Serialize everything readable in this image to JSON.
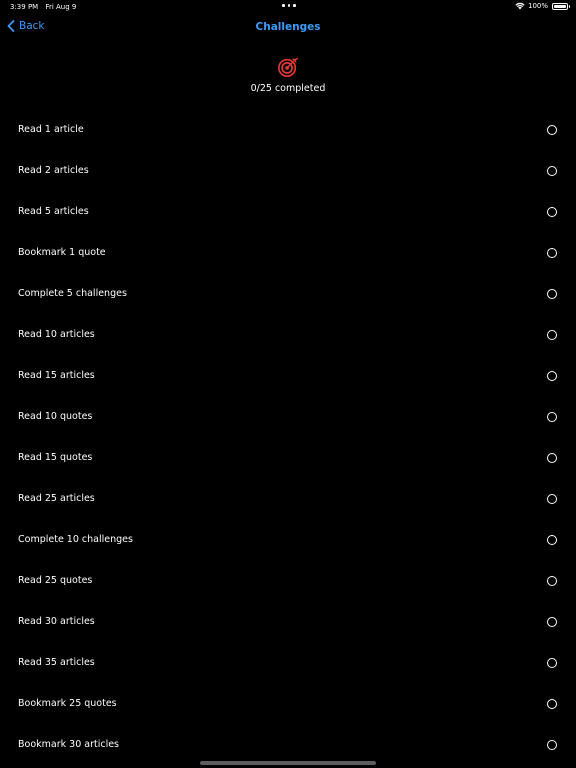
{
  "status_bar": {
    "time": "3:39 PM",
    "date": "Fri Aug 9",
    "battery_percent": "100%",
    "battery_level": 1.0,
    "icons": [
      "wifi-icon",
      "battery-icon"
    ]
  },
  "nav": {
    "back_label": "Back",
    "title": "Challenges",
    "accent_color": "#3f9bf7"
  },
  "header": {
    "icon": "target-icon",
    "icon_color": "#e53935",
    "progress_text": "0/25 completed"
  },
  "challenges": [
    {
      "label": "Read 1 article",
      "completed": false
    },
    {
      "label": "Read 2 articles",
      "completed": false
    },
    {
      "label": "Read 5 articles",
      "completed": false
    },
    {
      "label": "Bookmark 1 quote",
      "completed": false
    },
    {
      "label": "Complete 5 challenges",
      "completed": false
    },
    {
      "label": "Read 10 articles",
      "completed": false
    },
    {
      "label": "Read 15 articles",
      "completed": false
    },
    {
      "label": "Read 10 quotes",
      "completed": false
    },
    {
      "label": "Read 15 quotes",
      "completed": false
    },
    {
      "label": "Read 25 articles",
      "completed": false
    },
    {
      "label": "Complete 10 challenges",
      "completed": false
    },
    {
      "label": "Read 25 quotes",
      "completed": false
    },
    {
      "label": "Read 30 articles",
      "completed": false
    },
    {
      "label": "Read 35 articles",
      "completed": false
    },
    {
      "label": "Bookmark 25 quotes",
      "completed": false
    },
    {
      "label": "Bookmark 30 articles",
      "completed": false
    }
  ]
}
